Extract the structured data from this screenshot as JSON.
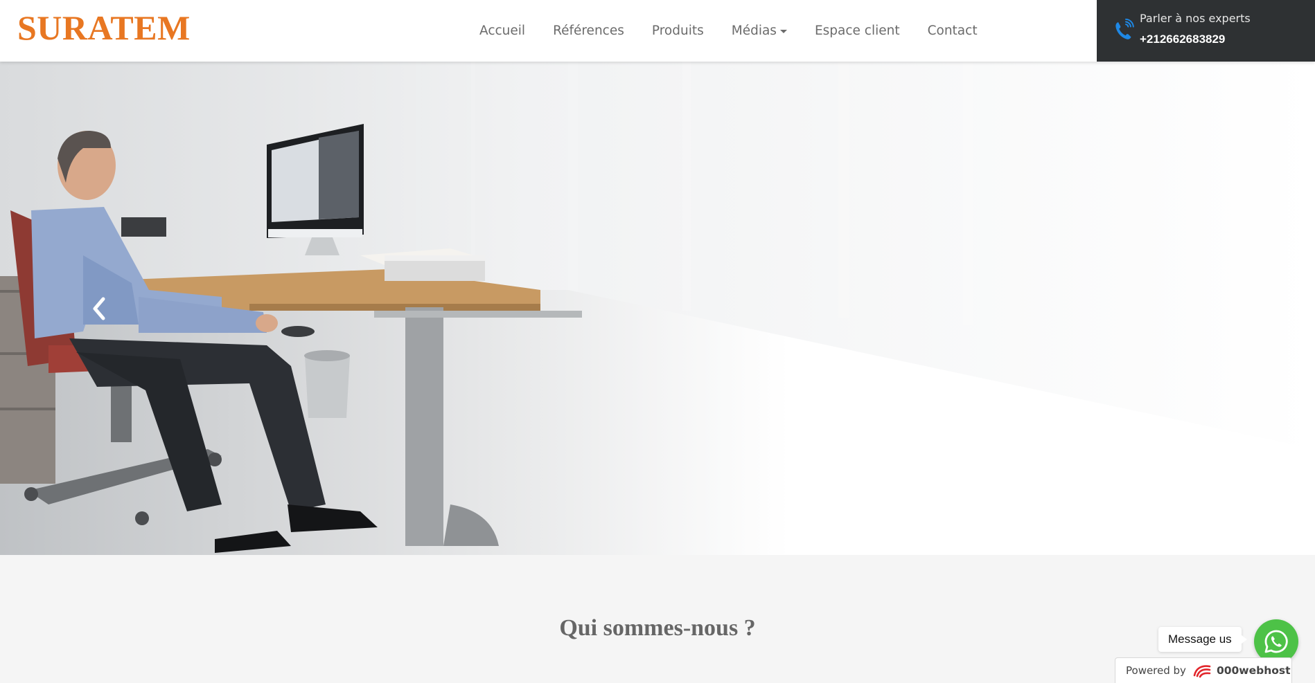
{
  "header": {
    "logo": "SURATEM",
    "nav": [
      {
        "label": "Accueil",
        "dropdown": false
      },
      {
        "label": "Références",
        "dropdown": false
      },
      {
        "label": "Produits",
        "dropdown": false
      },
      {
        "label": "Médias",
        "dropdown": true
      },
      {
        "label": "Espace client",
        "dropdown": false
      },
      {
        "label": "Contact",
        "dropdown": false
      }
    ],
    "experts": {
      "label": "Parler à nos experts",
      "phone": "+212662683829",
      "icon": "phone-ringing-icon"
    }
  },
  "hero": {
    "image": "man-at-desk-office-photo",
    "prev_icon": "chevron-left-icon"
  },
  "about": {
    "title": "Qui sommes-nous ?"
  },
  "widgets": {
    "message_label": "Message us",
    "whatsapp_icon": "whatsapp-icon",
    "powered_label": "Powered by",
    "powered_brand": "000webhost"
  },
  "colors": {
    "brand": "#e87722",
    "experts_bg": "#2e3133",
    "phone_icon": "#1e88e5",
    "whatsapp": "#4dc247",
    "about_bg": "#f5f5f5"
  }
}
